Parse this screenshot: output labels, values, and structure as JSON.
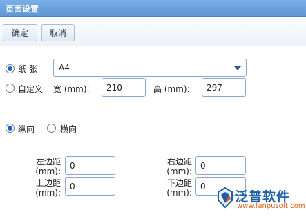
{
  "window": {
    "title": "页面设置"
  },
  "toolbar": {
    "confirm_label": "确定",
    "cancel_label": "取消"
  },
  "paper": {
    "preset_label": "纸 张",
    "preset_selected": true,
    "preset_value": "A4",
    "custom_label": "自定义",
    "custom_selected": false,
    "width_label": "宽 (mm):",
    "width_value": "210",
    "height_label": "高 (mm):",
    "height_value": "297"
  },
  "orientation": {
    "portrait_label": "纵向",
    "portrait_selected": true,
    "landscape_label": "横向",
    "landscape_selected": false
  },
  "margins": {
    "left_label_1": "左边距",
    "left_label_2": "(mm):",
    "left_value": "0",
    "right_label_1": "右边距",
    "right_label_2": "(mm):",
    "right_value": "0",
    "top_label_1": "上边距",
    "top_label_2": "(mm):",
    "top_value": "0",
    "bottom_label_1": "下边距",
    "bottom_label_2": "(mm):",
    "bottom_value": "0"
  },
  "watermark": {
    "brand": "泛普软件",
    "url": "www.fanpusoft.com",
    "icon": "fanpu-logo-icon"
  },
  "colors": {
    "titlebar": "#6aa3dd",
    "accent": "#1a66c9",
    "brand_blue": "#1d5ea8",
    "brand_orange": "#d85f1a"
  }
}
